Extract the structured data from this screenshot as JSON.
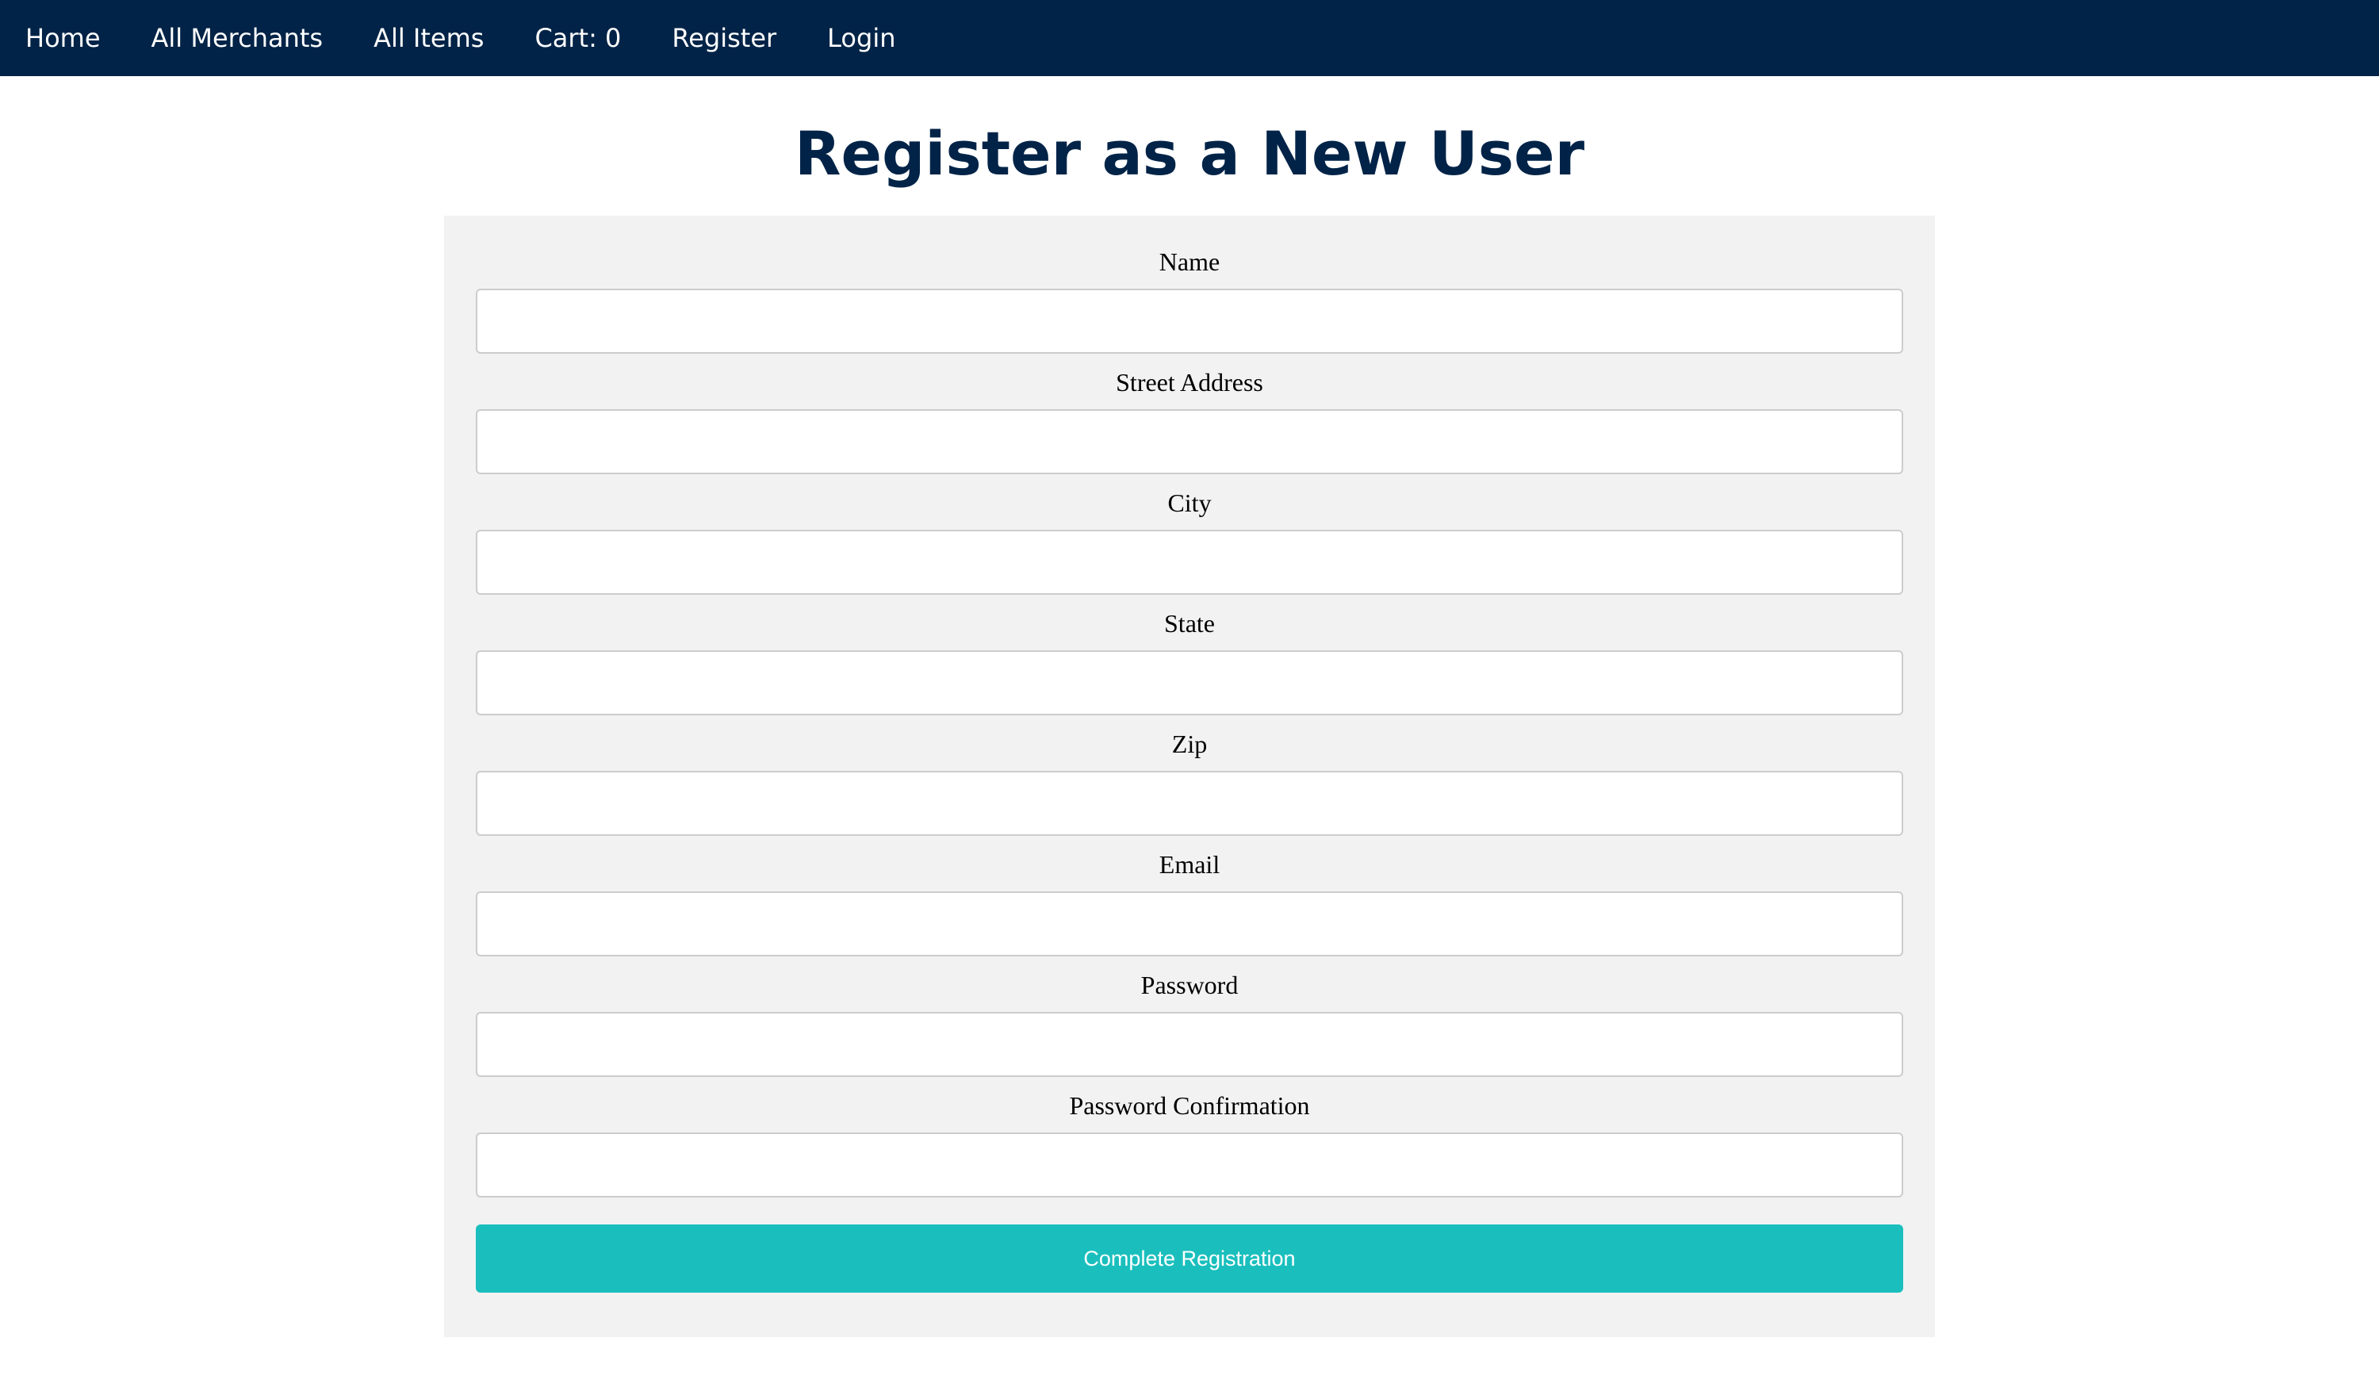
{
  "nav": {
    "items": [
      {
        "label": "Home"
      },
      {
        "label": "All Merchants"
      },
      {
        "label": "All Items"
      },
      {
        "label": "Cart: 0"
      },
      {
        "label": "Register"
      },
      {
        "label": "Login"
      }
    ]
  },
  "page": {
    "title": "Register as a New User"
  },
  "form": {
    "fields": [
      {
        "label": "Name",
        "value": ""
      },
      {
        "label": "Street Address",
        "value": ""
      },
      {
        "label": "City",
        "value": ""
      },
      {
        "label": "State",
        "value": ""
      },
      {
        "label": "Zip",
        "value": ""
      },
      {
        "label": "Email",
        "value": ""
      },
      {
        "label": "Password",
        "value": ""
      },
      {
        "label": "Password Confirmation",
        "value": ""
      }
    ],
    "submit_label": "Complete Registration"
  },
  "colors": {
    "nav_background": "#002347",
    "title": "#002347",
    "panel_background": "#f2f2f2",
    "button": "#1abfbd"
  }
}
